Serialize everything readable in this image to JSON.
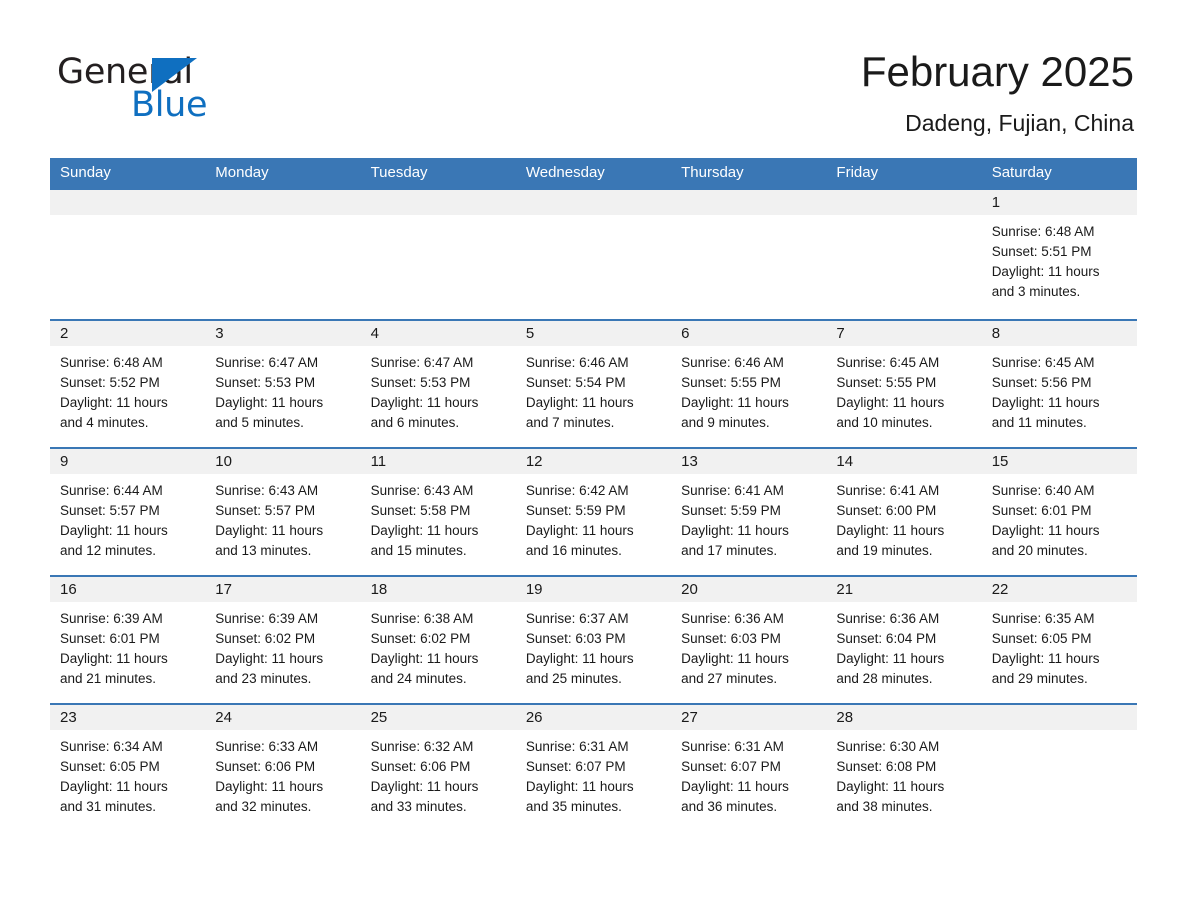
{
  "brand": {
    "name_part1": "General",
    "name_part2": "Blue",
    "triangle_color": "#0f6fc0"
  },
  "header": {
    "month_year": "February 2025",
    "location": "Dadeng, Fujian, China"
  },
  "theme": {
    "header_blue": "#3a77b5",
    "daynum_band": "#f1f1f1",
    "text": "#1a1a1a"
  },
  "weekday_headers": [
    "Sunday",
    "Monday",
    "Tuesday",
    "Wednesday",
    "Thursday",
    "Friday",
    "Saturday"
  ],
  "weeks": [
    {
      "days": [
        {
          "num": "",
          "sunrise": "",
          "sunset": "",
          "daylight1": "",
          "daylight2": ""
        },
        {
          "num": "",
          "sunrise": "",
          "sunset": "",
          "daylight1": "",
          "daylight2": ""
        },
        {
          "num": "",
          "sunrise": "",
          "sunset": "",
          "daylight1": "",
          "daylight2": ""
        },
        {
          "num": "",
          "sunrise": "",
          "sunset": "",
          "daylight1": "",
          "daylight2": ""
        },
        {
          "num": "",
          "sunrise": "",
          "sunset": "",
          "daylight1": "",
          "daylight2": ""
        },
        {
          "num": "",
          "sunrise": "",
          "sunset": "",
          "daylight1": "",
          "daylight2": ""
        },
        {
          "num": "1",
          "sunrise": "Sunrise: 6:48 AM",
          "sunset": "Sunset: 5:51 PM",
          "daylight1": "Daylight: 11 hours",
          "daylight2": "and 3 minutes."
        }
      ]
    },
    {
      "days": [
        {
          "num": "2",
          "sunrise": "Sunrise: 6:48 AM",
          "sunset": "Sunset: 5:52 PM",
          "daylight1": "Daylight: 11 hours",
          "daylight2": "and 4 minutes."
        },
        {
          "num": "3",
          "sunrise": "Sunrise: 6:47 AM",
          "sunset": "Sunset: 5:53 PM",
          "daylight1": "Daylight: 11 hours",
          "daylight2": "and 5 minutes."
        },
        {
          "num": "4",
          "sunrise": "Sunrise: 6:47 AM",
          "sunset": "Sunset: 5:53 PM",
          "daylight1": "Daylight: 11 hours",
          "daylight2": "and 6 minutes."
        },
        {
          "num": "5",
          "sunrise": "Sunrise: 6:46 AM",
          "sunset": "Sunset: 5:54 PM",
          "daylight1": "Daylight: 11 hours",
          "daylight2": "and 7 minutes."
        },
        {
          "num": "6",
          "sunrise": "Sunrise: 6:46 AM",
          "sunset": "Sunset: 5:55 PM",
          "daylight1": "Daylight: 11 hours",
          "daylight2": "and 9 minutes."
        },
        {
          "num": "7",
          "sunrise": "Sunrise: 6:45 AM",
          "sunset": "Sunset: 5:55 PM",
          "daylight1": "Daylight: 11 hours",
          "daylight2": "and 10 minutes."
        },
        {
          "num": "8",
          "sunrise": "Sunrise: 6:45 AM",
          "sunset": "Sunset: 5:56 PM",
          "daylight1": "Daylight: 11 hours",
          "daylight2": "and 11 minutes."
        }
      ]
    },
    {
      "days": [
        {
          "num": "9",
          "sunrise": "Sunrise: 6:44 AM",
          "sunset": "Sunset: 5:57 PM",
          "daylight1": "Daylight: 11 hours",
          "daylight2": "and 12 minutes."
        },
        {
          "num": "10",
          "sunrise": "Sunrise: 6:43 AM",
          "sunset": "Sunset: 5:57 PM",
          "daylight1": "Daylight: 11 hours",
          "daylight2": "and 13 minutes."
        },
        {
          "num": "11",
          "sunrise": "Sunrise: 6:43 AM",
          "sunset": "Sunset: 5:58 PM",
          "daylight1": "Daylight: 11 hours",
          "daylight2": "and 15 minutes."
        },
        {
          "num": "12",
          "sunrise": "Sunrise: 6:42 AM",
          "sunset": "Sunset: 5:59 PM",
          "daylight1": "Daylight: 11 hours",
          "daylight2": "and 16 minutes."
        },
        {
          "num": "13",
          "sunrise": "Sunrise: 6:41 AM",
          "sunset": "Sunset: 5:59 PM",
          "daylight1": "Daylight: 11 hours",
          "daylight2": "and 17 minutes."
        },
        {
          "num": "14",
          "sunrise": "Sunrise: 6:41 AM",
          "sunset": "Sunset: 6:00 PM",
          "daylight1": "Daylight: 11 hours",
          "daylight2": "and 19 minutes."
        },
        {
          "num": "15",
          "sunrise": "Sunrise: 6:40 AM",
          "sunset": "Sunset: 6:01 PM",
          "daylight1": "Daylight: 11 hours",
          "daylight2": "and 20 minutes."
        }
      ]
    },
    {
      "days": [
        {
          "num": "16",
          "sunrise": "Sunrise: 6:39 AM",
          "sunset": "Sunset: 6:01 PM",
          "daylight1": "Daylight: 11 hours",
          "daylight2": "and 21 minutes."
        },
        {
          "num": "17",
          "sunrise": "Sunrise: 6:39 AM",
          "sunset": "Sunset: 6:02 PM",
          "daylight1": "Daylight: 11 hours",
          "daylight2": "and 23 minutes."
        },
        {
          "num": "18",
          "sunrise": "Sunrise: 6:38 AM",
          "sunset": "Sunset: 6:02 PM",
          "daylight1": "Daylight: 11 hours",
          "daylight2": "and 24 minutes."
        },
        {
          "num": "19",
          "sunrise": "Sunrise: 6:37 AM",
          "sunset": "Sunset: 6:03 PM",
          "daylight1": "Daylight: 11 hours",
          "daylight2": "and 25 minutes."
        },
        {
          "num": "20",
          "sunrise": "Sunrise: 6:36 AM",
          "sunset": "Sunset: 6:03 PM",
          "daylight1": "Daylight: 11 hours",
          "daylight2": "and 27 minutes."
        },
        {
          "num": "21",
          "sunrise": "Sunrise: 6:36 AM",
          "sunset": "Sunset: 6:04 PM",
          "daylight1": "Daylight: 11 hours",
          "daylight2": "and 28 minutes."
        },
        {
          "num": "22",
          "sunrise": "Sunrise: 6:35 AM",
          "sunset": "Sunset: 6:05 PM",
          "daylight1": "Daylight: 11 hours",
          "daylight2": "and 29 minutes."
        }
      ]
    },
    {
      "days": [
        {
          "num": "23",
          "sunrise": "Sunrise: 6:34 AM",
          "sunset": "Sunset: 6:05 PM",
          "daylight1": "Daylight: 11 hours",
          "daylight2": "and 31 minutes."
        },
        {
          "num": "24",
          "sunrise": "Sunrise: 6:33 AM",
          "sunset": "Sunset: 6:06 PM",
          "daylight1": "Daylight: 11 hours",
          "daylight2": "and 32 minutes."
        },
        {
          "num": "25",
          "sunrise": "Sunrise: 6:32 AM",
          "sunset": "Sunset: 6:06 PM",
          "daylight1": "Daylight: 11 hours",
          "daylight2": "and 33 minutes."
        },
        {
          "num": "26",
          "sunrise": "Sunrise: 6:31 AM",
          "sunset": "Sunset: 6:07 PM",
          "daylight1": "Daylight: 11 hours",
          "daylight2": "and 35 minutes."
        },
        {
          "num": "27",
          "sunrise": "Sunrise: 6:31 AM",
          "sunset": "Sunset: 6:07 PM",
          "daylight1": "Daylight: 11 hours",
          "daylight2": "and 36 minutes."
        },
        {
          "num": "28",
          "sunrise": "Sunrise: 6:30 AM",
          "sunset": "Sunset: 6:08 PM",
          "daylight1": "Daylight: 11 hours",
          "daylight2": "and 38 minutes."
        },
        {
          "num": "",
          "sunrise": "",
          "sunset": "",
          "daylight1": "",
          "daylight2": ""
        }
      ]
    }
  ]
}
